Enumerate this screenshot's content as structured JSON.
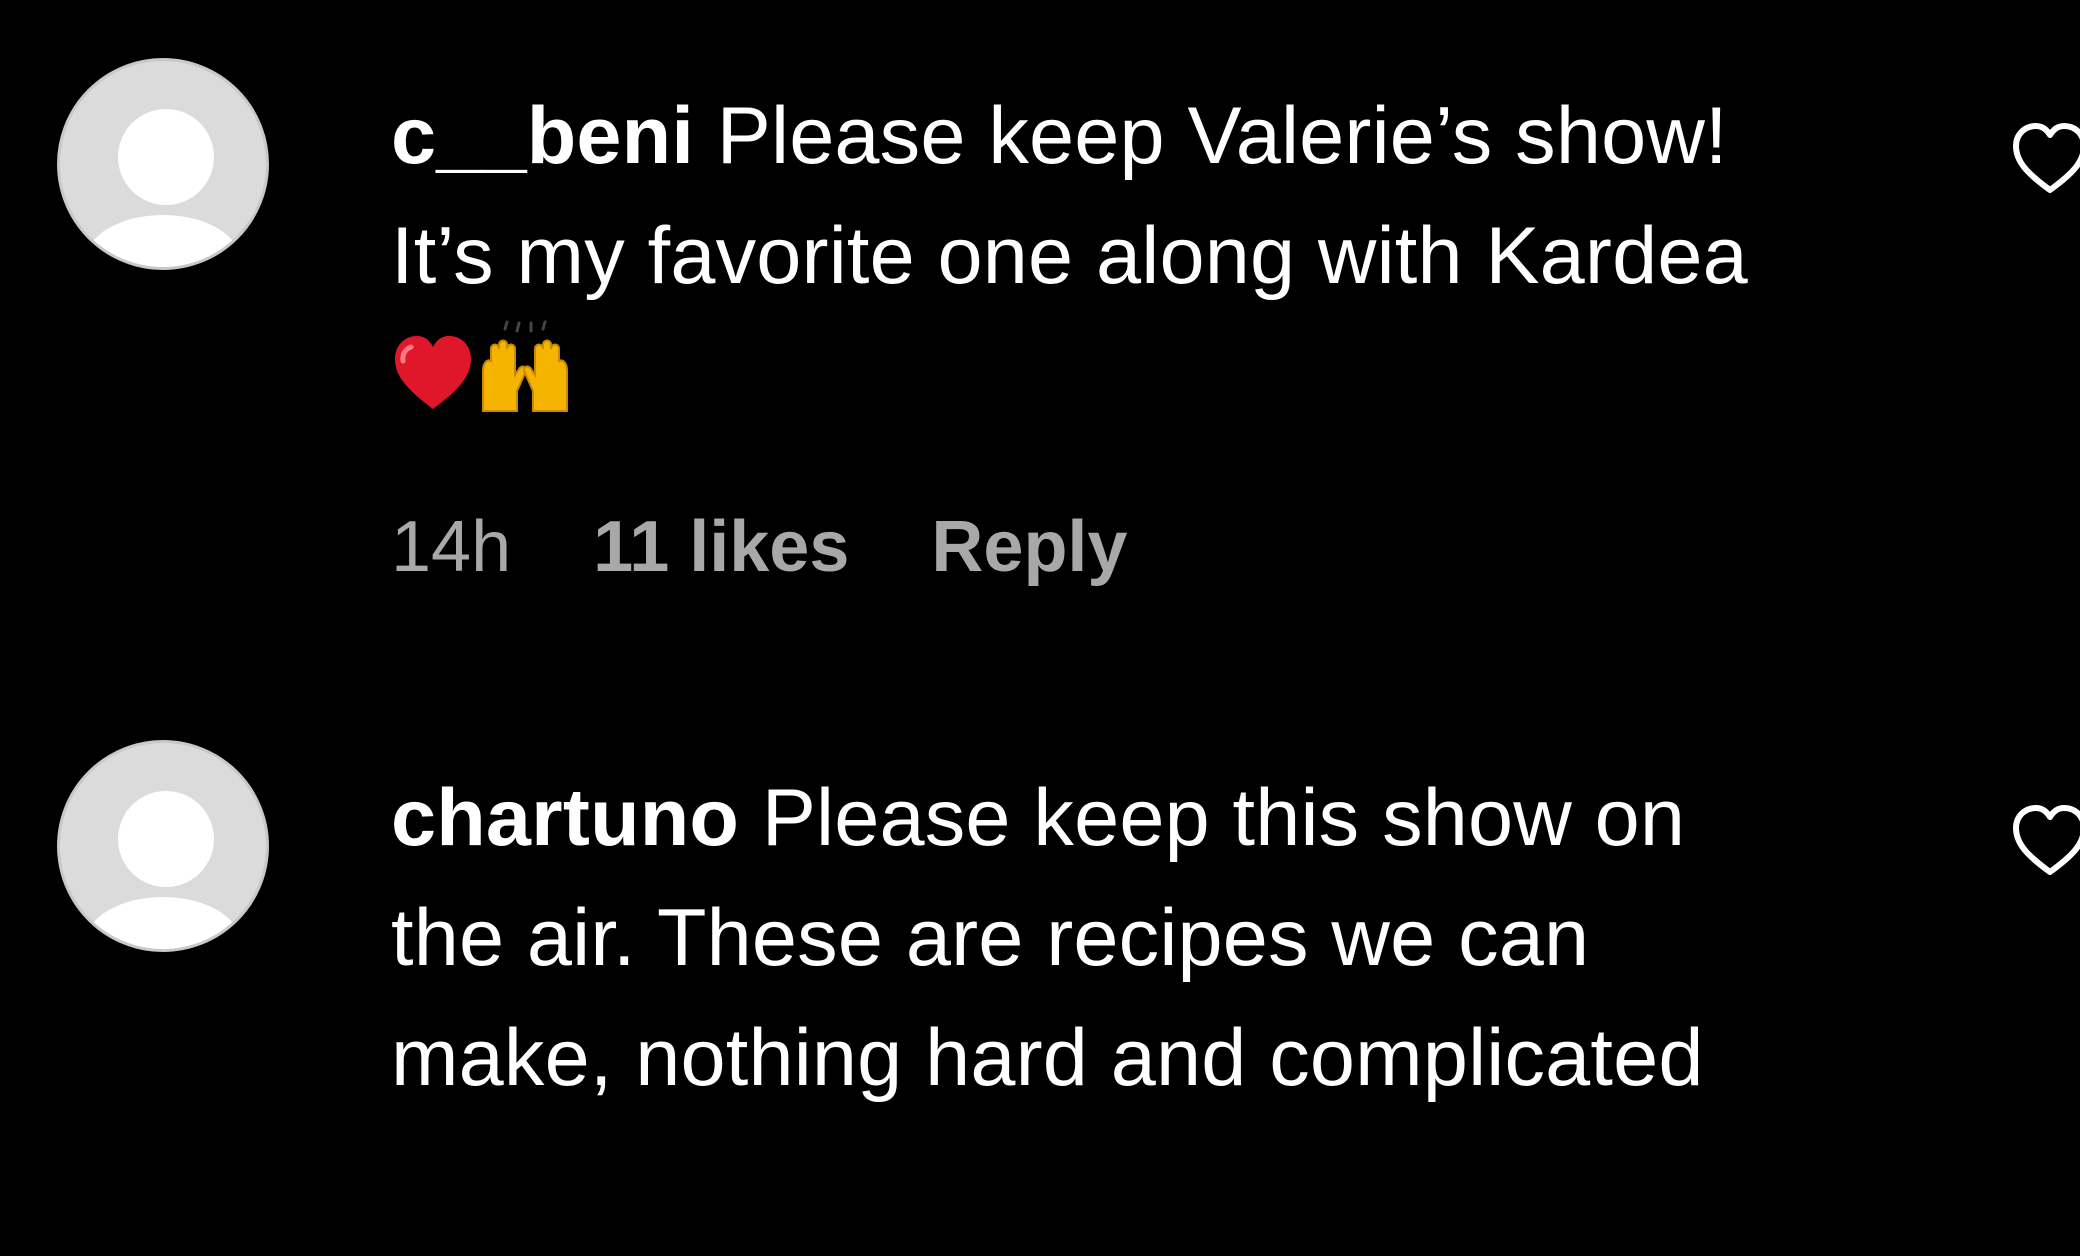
{
  "comments": [
    {
      "username": "c__beni",
      "text": " Please keep Valerie’s show! It’s my favorite one along with Kardea",
      "emojis": [
        "red-heart",
        "raising-hands"
      ],
      "time": "14h",
      "likes": "11 likes",
      "reply_label": "Reply",
      "like_icon": "heart-outline-icon"
    },
    {
      "username": "chartuno",
      "text": " Please keep this show on the air. These are recipes we can make, nothing hard and complicated",
      "like_icon": "heart-outline-icon"
    }
  ],
  "colors": {
    "background": "#000000",
    "text": "#ffffff",
    "meta": "#a8a8a8",
    "avatar_bg": "#dbdbdb",
    "heart": "#e0162b",
    "hands": "#f5b400"
  }
}
